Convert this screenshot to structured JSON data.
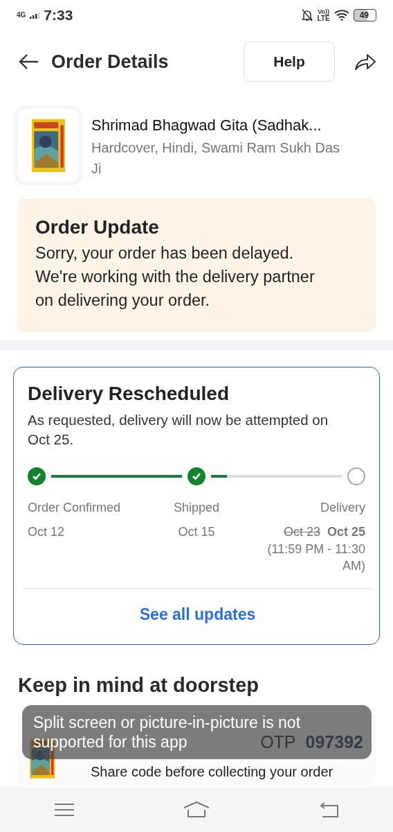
{
  "status_bar": {
    "network": "4G",
    "time": "7:33",
    "battery": "49",
    "volte": "Vo))",
    "lte": "LTE"
  },
  "header": {
    "title": "Order Details",
    "help": "Help"
  },
  "product": {
    "title": "Shrimad Bhagwad Gita (Sadhak...",
    "subtitle": "Hardcover, Hindi, Swami Ram Sukh Das Ji"
  },
  "order_update": {
    "title": "Order Update",
    "message": "Sorry, your order has been delayed. We're working with the delivery partner on delivering your order."
  },
  "delivery": {
    "title": "Delivery Rescheduled",
    "message": "As requested, delivery will now be attempted on Oct 25.",
    "steps": [
      {
        "label": "Order Confirmed",
        "date": "Oct 12",
        "done": true
      },
      {
        "label": "Shipped",
        "date": "Oct 15",
        "done": true
      },
      {
        "label": "Delivery",
        "old_date": "Oct 23",
        "date": "Oct 25",
        "time": "(11:59 PM - 11:30 AM)",
        "done": false
      }
    ],
    "connectors": [
      {
        "level": 1
      },
      {
        "level": 0.12
      }
    ],
    "link": "See all updates"
  },
  "doorstep": {
    "title": "Keep in mind at doorstep",
    "otp_label": "OTP",
    "otp": "097392",
    "note": "Share code before collecting your order"
  },
  "toast": "Split screen or picture-in-picture is not supported for this app"
}
